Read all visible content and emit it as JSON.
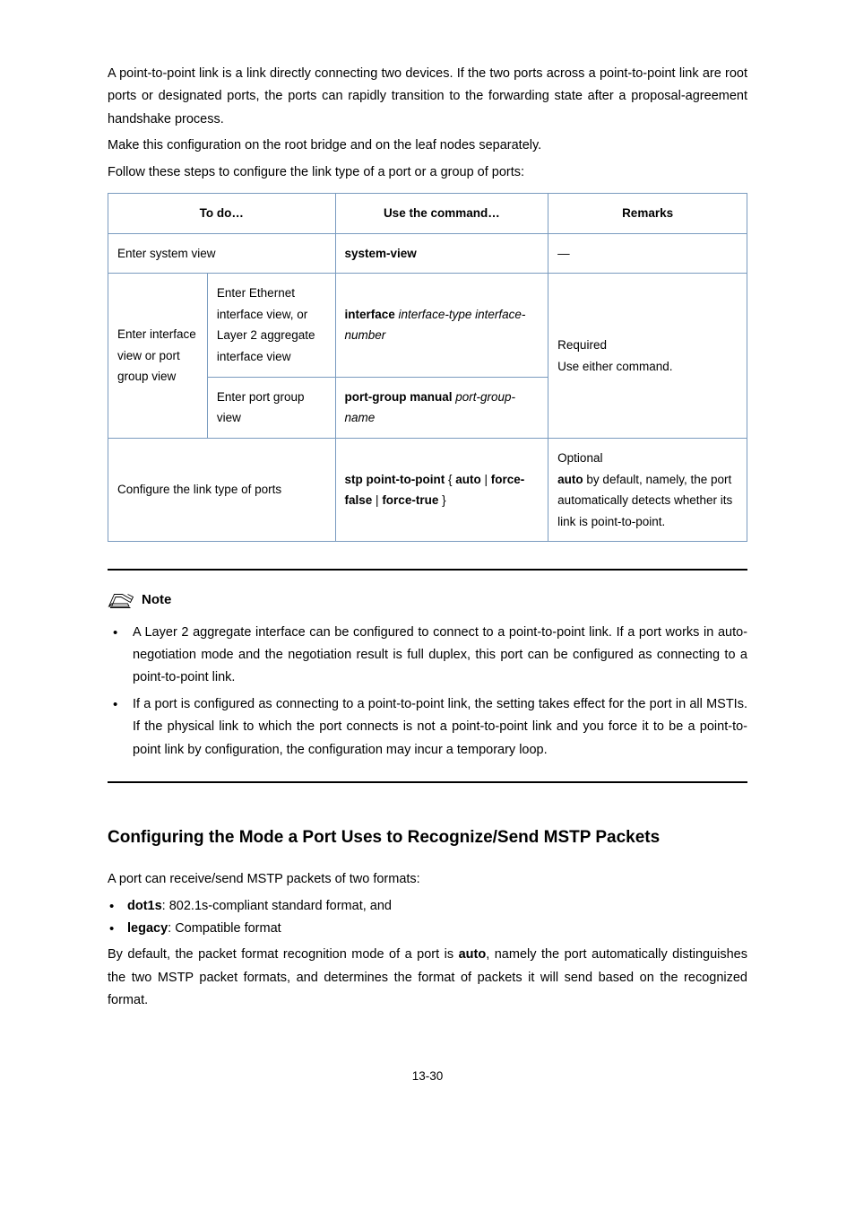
{
  "intro": {
    "p1": "A point-to-point link is a link directly connecting two devices. If the two ports across a point-to-point link are root ports or designated ports, the ports can rapidly transition to the forwarding state after a proposal-agreement handshake process.",
    "p2": "Make this configuration on the root bridge and on the leaf nodes separately.",
    "p3": "Follow these steps to configure the link type of a port or a group of ports:"
  },
  "table": {
    "head": {
      "to": "To do…",
      "use": "Use the command…",
      "remarks": "Remarks"
    },
    "row1": {
      "to": "Enter system view",
      "cmd": "system-view",
      "remarks": "—"
    },
    "row2": {
      "to_group": "Enter interface view or port group view",
      "sub1_label": "Enter Ethernet interface view, or Layer 2 aggregate interface view",
      "sub1_cmd_a": "interface",
      "sub1_cmd_b": "interface-type interface-number",
      "sub2_label": "Enter port group view",
      "sub2_cmd_a": "port-group manual",
      "sub2_cmd_b": "port-group-name",
      "remarks_a": "Required",
      "remarks_b": "Use either command."
    },
    "row3": {
      "to": "Configure the link type of ports",
      "cmd_prefix": "stp point-to-point",
      "cmd_opt1": "auto",
      "cmd_opt2": "force-false",
      "cmd_opt3": "force-true",
      "remarks_a": "Optional",
      "remarks_b_1": "auto",
      "remarks_b_2": " by default, namely, the port automatically detects whether its link is point-to-point."
    }
  },
  "note": {
    "label": "Note",
    "b1": "A Layer 2 aggregate interface can be configured to connect to a point-to-point link. If a port works in auto-negotiation mode and the negotiation result is full duplex, this port can be configured as connecting to a point-to-point link.",
    "b2": "If a port is configured as connecting to a point-to-point link, the setting takes effect for the port in all MSTIs. If the physical link to which the port connects is not a point-to-point link and you force it to be a point-to-point link by configuration, the configuration may incur a temporary loop."
  },
  "section": {
    "title": "Configuring the Mode a Port Uses to Recognize/Send MSTP Packets",
    "p1": "A port can receive/send MSTP packets of two formats:",
    "b1_a": "dot1s",
    "b1_b": ": 802.1s-compliant standard format, and",
    "b2_a": "legacy",
    "b2_b": ": Compatible format",
    "p2_a": "By default, the packet format recognition mode of a port is ",
    "p2_b": "auto",
    "p2_c": ", namely the port automatically distinguishes the two MSTP packet formats, and determines the format of packets it will send based on the recognized format."
  },
  "pagenum": "13-30"
}
